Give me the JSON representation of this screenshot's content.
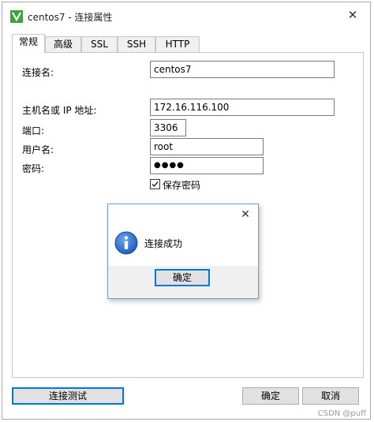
{
  "window": {
    "title": "centos7 - 连接属性"
  },
  "tabs": [
    {
      "label": "常规",
      "active": true
    },
    {
      "label": "高级",
      "active": false
    },
    {
      "label": "SSL",
      "active": false
    },
    {
      "label": "SSH",
      "active": false
    },
    {
      "label": "HTTP",
      "active": false
    }
  ],
  "form": {
    "connection_name_label": "连接名:",
    "connection_name_value": "centos7",
    "host_label": "主机名或 IP 地址:",
    "host_value": "172.16.116.100",
    "port_label": "端口:",
    "port_value": "3306",
    "username_label": "用户名:",
    "username_value": "root",
    "password_label": "密码:",
    "password_masked": "●●●●",
    "save_password_label": "保存密码",
    "save_password_checked": true
  },
  "dialog": {
    "message": "连接成功",
    "ok_label": "确定",
    "icon": "info-icon"
  },
  "footer": {
    "test_connection_label": "连接测试",
    "ok_label": "确定",
    "cancel_label": "取消"
  },
  "watermark": "CSDN @puff",
  "colors": {
    "accent": "#0078d7",
    "info_blue": "#1d5fbf",
    "app_icon_green": "#3aa53a"
  }
}
